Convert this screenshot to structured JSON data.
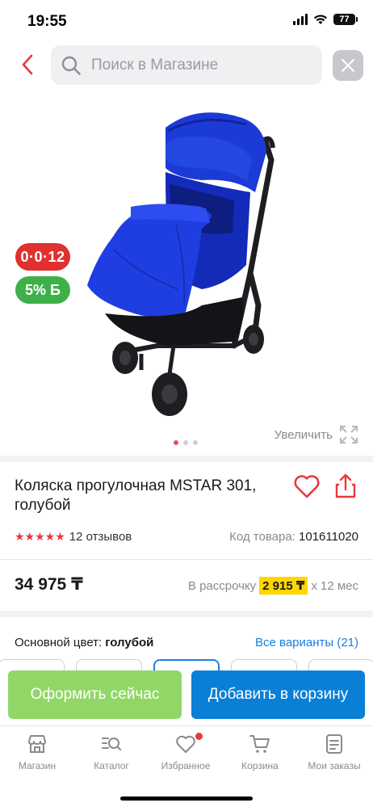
{
  "status": {
    "time": "19:55",
    "battery": "77"
  },
  "search": {
    "placeholder": "Поиск в Магазине"
  },
  "gallery": {
    "badge_installment": "0·0·12",
    "badge_bonus": "5% Б",
    "zoom_label": "Увеличить",
    "slides": 3,
    "active_slide": 1
  },
  "product": {
    "title": "Коляска прогулочная MSTAR 301, голубой",
    "stars": "★★★★★",
    "rating": 5,
    "reviews": "12 отзывов",
    "sku_label": "Код товара:",
    "sku": "101611020"
  },
  "pricing": {
    "price": "34 975 ₸",
    "installment_prefix": "В рассрочку",
    "installment_amount": "2 915 ₸",
    "installment_suffix": "x 12 мес"
  },
  "color": {
    "label": "Основной цвет:",
    "value": "голубой",
    "all_variants": "Все варианты (21)"
  },
  "actions": {
    "buy_now": "Оформить сейчас",
    "add_to_cart": "Добавить в корзину"
  },
  "tabs": [
    {
      "label": "Магазин",
      "icon": "store-icon"
    },
    {
      "label": "Каталог",
      "icon": "catalog-search-icon"
    },
    {
      "label": "Избранное",
      "icon": "heart-icon"
    },
    {
      "label": "Корзина",
      "icon": "cart-icon"
    },
    {
      "label": "Мои заказы",
      "icon": "orders-icon"
    }
  ],
  "colors": {
    "accent_red": "#e8393f",
    "buy_green": "#91d767",
    "cart_blue": "#0a7fd6",
    "link_blue": "#1a7ee0",
    "installment_yellow": "#ffd600",
    "bonus_green": "#3eb049"
  }
}
